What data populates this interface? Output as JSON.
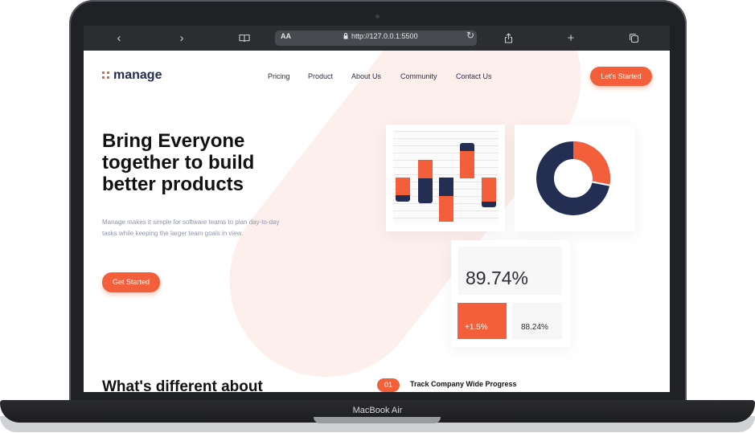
{
  "device": {
    "brand_label": "MacBook Air"
  },
  "browser": {
    "text_size_label": "AA",
    "url": "http://127.0.0.1:5500",
    "icons": [
      "chevron-left-icon",
      "chevron-right-icon",
      "book-icon",
      "lock-icon",
      "reload-icon",
      "share-icon",
      "plus-icon",
      "tabs-icon"
    ]
  },
  "site": {
    "logo_text": "manage",
    "nav": [
      "Pricing",
      "Product",
      "About Us",
      "Community",
      "Contact Us"
    ],
    "header_cta": "Let's Started",
    "hero": {
      "title": "Bring Everyone together to build better products",
      "body": "Manage makes it simple for software teams to plan day-to-day tasks while keeping the larger team goals in view.",
      "cta": "Get Started"
    },
    "stats": {
      "big_value": "89.74%",
      "delta": "+1.5%",
      "secondary_value": "88.24%"
    },
    "donut": {
      "orange_fraction": 0.28
    },
    "section_heading": "What's different about",
    "feature": {
      "number": "01",
      "title": "Track Company Wide Progress"
    }
  },
  "colors": {
    "accent": "#f25f3a",
    "navy": "#242d52",
    "blob": "#fdf0ec"
  }
}
